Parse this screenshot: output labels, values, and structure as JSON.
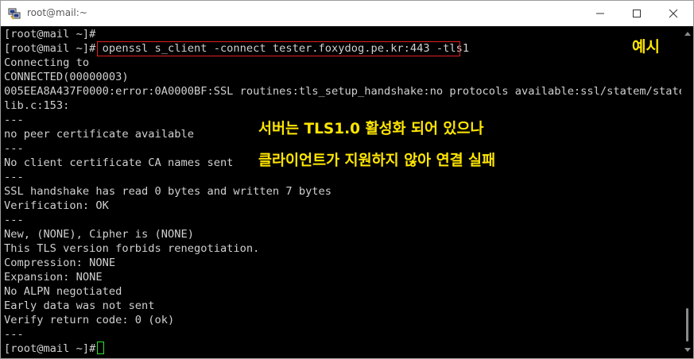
{
  "window": {
    "title": "root@mail:~"
  },
  "terminal": {
    "lines": [
      "[root@mail ~]#",
      "[root@mail ~]# openssl s_client -connect tester.foxydog.pe.kr:443 -tls1",
      "Connecting to",
      "CONNECTED(00000003)",
      "005EEA8A437F0000:error:0A0000BF:SSL routines:tls_setup_handshake:no protocols available:ssl/statem/statem_",
      "lib.c:153:",
      "---",
      "no peer certificate available",
      "---",
      "No client certificate CA names sent",
      "---",
      "SSL handshake has read 0 bytes and written 7 bytes",
      "Verification: OK",
      "---",
      "New, (NONE), Cipher is (NONE)",
      "This TLS version forbids renegotiation.",
      "Compression: NONE",
      "Expansion: NONE",
      "No ALPN negotiated",
      "Early data was not sent",
      "Verify return code: 0 (ok)",
      "---",
      "[root@mail ~]# "
    ]
  },
  "annotations": {
    "example_label": "예시",
    "note_line1": "서버는 TLS1.0 활성화 되어 있으나",
    "note_line2": "클라이언트가 지원하지 않아 연결 실패"
  },
  "colors": {
    "terminal_bg": "#000000",
    "terminal_text": "#d0d0d0",
    "annotation": "#ffe600",
    "command_highlight": "#e02020",
    "cursor": "#2ee02e"
  },
  "icons": {
    "app": "putty-icon",
    "minimize": "minimize-icon",
    "maximize": "maximize-icon",
    "close": "close-icon"
  }
}
